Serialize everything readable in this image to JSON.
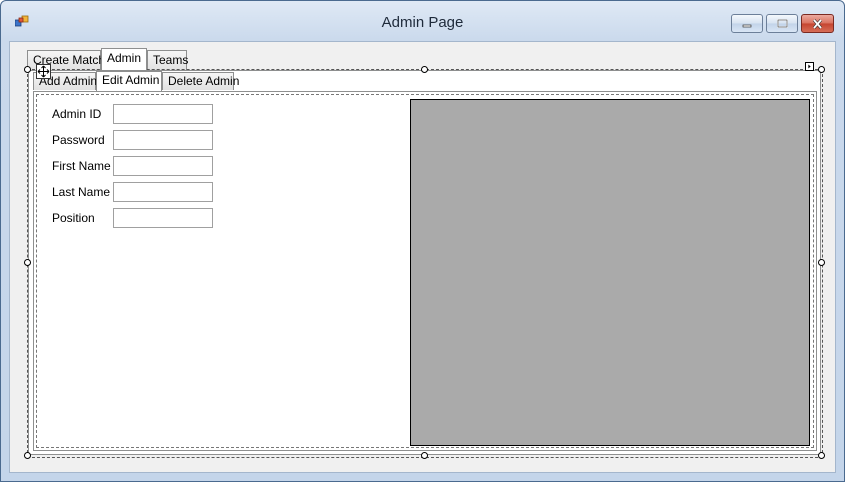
{
  "window": {
    "title": "Admin Page"
  },
  "outer_tabs": [
    "Create Match",
    "Admin",
    "Teams"
  ],
  "outer_active": "Admin",
  "inner_tabs": [
    "Add Admin",
    "Edit Admin",
    "Delete Admin"
  ],
  "inner_active": "Edit Admin",
  "form": {
    "admin_id_label": "Admin ID",
    "admin_id_value": "",
    "password_label": "Password",
    "password_value": "",
    "first_name_label": "First Name",
    "first_name_value": "",
    "last_name_label": "Last Name",
    "last_name_value": "",
    "position_label": "Position",
    "position_value": ""
  },
  "colors": {
    "picture_box": "#aaaaaa",
    "close_button": "#c5442f"
  }
}
